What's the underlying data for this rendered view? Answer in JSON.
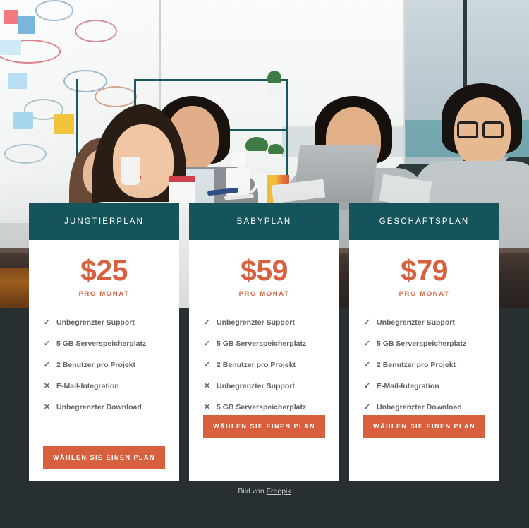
{
  "page": {
    "background_color": "#272f30",
    "accent_color": "#d9603f",
    "header_color": "#15545a"
  },
  "hero": {
    "alt": "office-meeting-photo"
  },
  "pricing": {
    "cards": [
      {
        "title": "JUNGTIERPLAN",
        "price": "$25",
        "period": "PRO MONAT",
        "features": [
          {
            "mark": "✓",
            "included": true,
            "label": "Unbegrenzter Support"
          },
          {
            "mark": "✓",
            "included": true,
            "label": "5 GB Serverspeicherplatz"
          },
          {
            "mark": "✓",
            "included": true,
            "label": "2 Benutzer pro Projekt"
          },
          {
            "mark": "✕",
            "included": false,
            "label": "E-Mail-Integration"
          },
          {
            "mark": "✕",
            "included": false,
            "label": "Unbegrenzter Download"
          }
        ],
        "cta": "WÄHLEN SIE EINEN PLAN"
      },
      {
        "title": "BABYPLAN",
        "price": "$59",
        "period": "PRO MONAT",
        "features": [
          {
            "mark": "✓",
            "included": true,
            "label": "Unbegrenzter Support"
          },
          {
            "mark": "✓",
            "included": true,
            "label": "5 GB Serverspeicherplatz"
          },
          {
            "mark": "✓",
            "included": true,
            "label": "2 Benutzer pro Projekt"
          },
          {
            "mark": "✕",
            "included": false,
            "label": "Unbegrenzter Support"
          },
          {
            "mark": "✕",
            "included": false,
            "label": "5 GB Serverspeicherplatz"
          }
        ],
        "cta": "WÄHLEN SIE EINEN PLAN"
      },
      {
        "title": "GESCHÄFTSPLAN",
        "price": "$79",
        "period": "PRO MONAT",
        "features": [
          {
            "mark": "✓",
            "included": true,
            "label": "Unbegrenzter Support"
          },
          {
            "mark": "✓",
            "included": true,
            "label": "5 GB Serverspeicherplatz"
          },
          {
            "mark": "✓",
            "included": true,
            "label": "2 Benutzer pro Projekt"
          },
          {
            "mark": "✓",
            "included": true,
            "label": "E-Mail-Integration"
          },
          {
            "mark": "✓",
            "included": true,
            "label": "Unbegrenzter Download"
          }
        ],
        "cta": "WÄHLEN SIE EINEN PLAN"
      }
    ]
  },
  "footer": {
    "prefix": "Bild von ",
    "link": "Freepik"
  }
}
